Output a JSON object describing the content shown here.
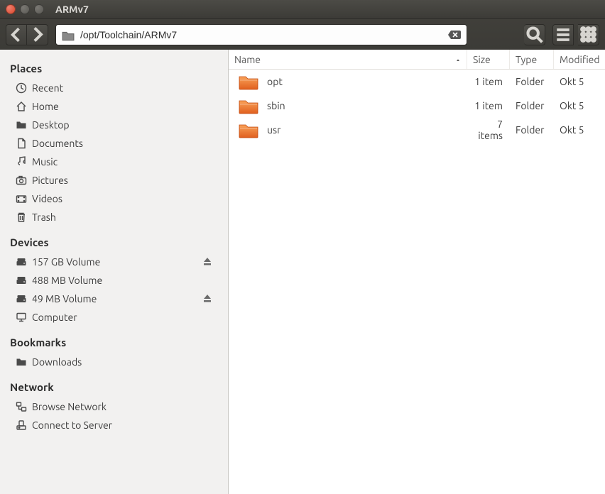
{
  "window": {
    "title": "ARMv7"
  },
  "toolbar": {
    "path": "/opt/Toolchain/ARMv7"
  },
  "sidebar": {
    "places": {
      "header": "Places",
      "items": [
        {
          "icon": "clock-icon",
          "label": "Recent"
        },
        {
          "icon": "home-icon",
          "label": "Home"
        },
        {
          "icon": "folder-icon",
          "label": "Desktop"
        },
        {
          "icon": "document-icon",
          "label": "Documents"
        },
        {
          "icon": "music-icon",
          "label": "Music"
        },
        {
          "icon": "camera-icon",
          "label": "Pictures"
        },
        {
          "icon": "video-icon",
          "label": "Videos"
        },
        {
          "icon": "trash-icon",
          "label": "Trash"
        }
      ]
    },
    "devices": {
      "header": "Devices",
      "items": [
        {
          "icon": "drive-icon",
          "label": "157 GB Volume",
          "eject": true
        },
        {
          "icon": "drive-icon",
          "label": "488 MB Volume"
        },
        {
          "icon": "drive-icon",
          "label": "49 MB Volume",
          "eject": true
        },
        {
          "icon": "computer-icon",
          "label": "Computer"
        }
      ]
    },
    "bookmarks": {
      "header": "Bookmarks",
      "items": [
        {
          "icon": "folder-icon",
          "label": "Downloads"
        }
      ]
    },
    "network": {
      "header": "Network",
      "items": [
        {
          "icon": "network-icon",
          "label": "Browse Network"
        },
        {
          "icon": "server-icon",
          "label": "Connect to Server"
        }
      ]
    }
  },
  "columns": {
    "name": "Name",
    "size": "Size",
    "type": "Type",
    "modified": "Modified"
  },
  "files": [
    {
      "name": "opt",
      "size": "1 item",
      "type": "Folder",
      "modified": "Okt 5"
    },
    {
      "name": "sbin",
      "size": "1 item",
      "type": "Folder",
      "modified": "Okt 5"
    },
    {
      "name": "usr",
      "size": "7 items",
      "type": "Folder",
      "modified": "Okt 5"
    }
  ]
}
